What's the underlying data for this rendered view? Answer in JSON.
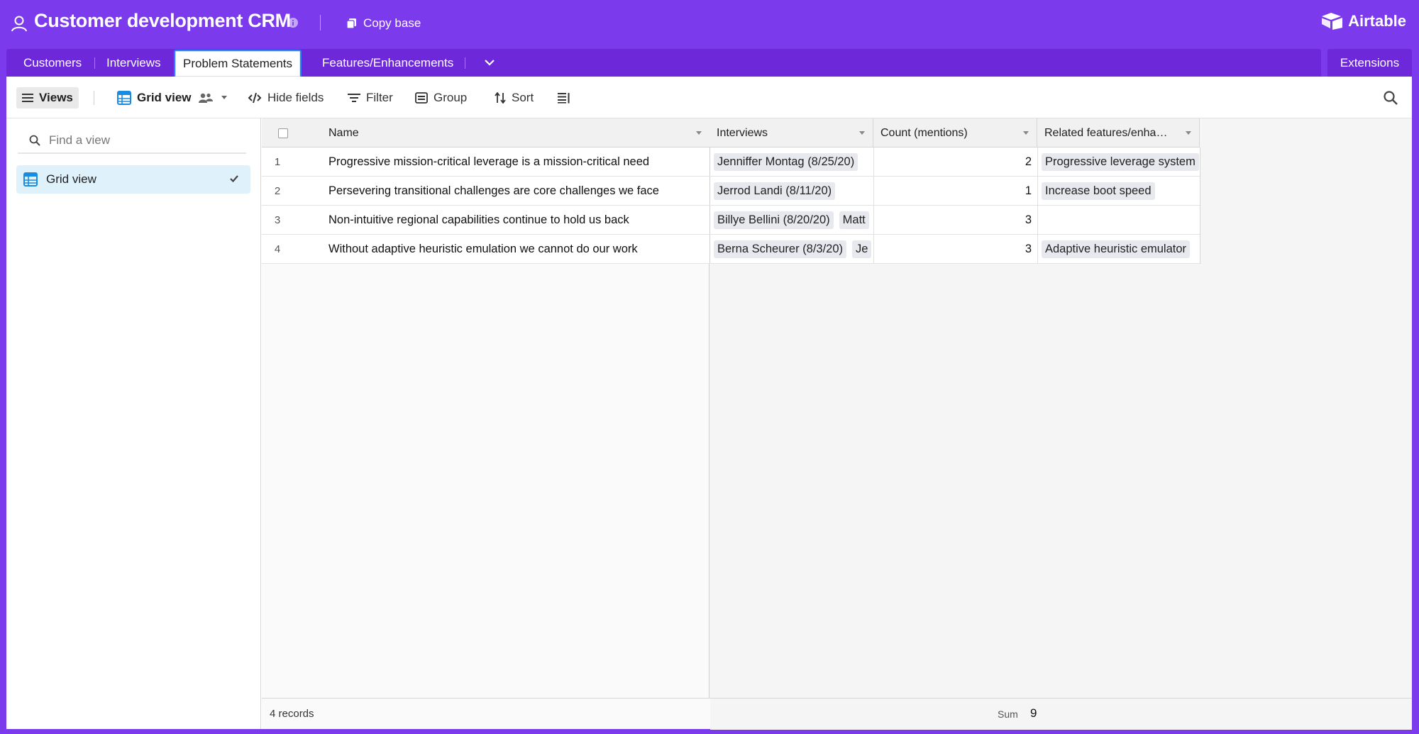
{
  "base": {
    "title": "Customer development CRM",
    "copy_label": "Copy base",
    "brand": "Airtable"
  },
  "tabs": [
    {
      "label": "Customers"
    },
    {
      "label": "Interviews"
    },
    {
      "label": "Problem Statements",
      "active": true
    },
    {
      "label": "Features/Enhancements"
    }
  ],
  "extensions_label": "Extensions",
  "toolbar": {
    "views_label": "Views",
    "grid_view_label": "Grid view",
    "hide_fields_label": "Hide fields",
    "filter_label": "Filter",
    "group_label": "Group",
    "sort_label": "Sort"
  },
  "sidebar": {
    "find_placeholder": "Find a view",
    "items": [
      {
        "label": "Grid view",
        "selected": true
      }
    ]
  },
  "grid": {
    "columns": [
      "Name",
      "Interviews",
      "Count (mentions)",
      "Related features/enha…"
    ],
    "rows": [
      {
        "num": "1",
        "name": "Progressive mission-critical leverage is a mission-critical need",
        "interviews": [
          "Jenniffer Montag (8/25/20)"
        ],
        "count": "2",
        "related": [
          "Progressive leverage system"
        ]
      },
      {
        "num": "2",
        "name": "Persevering transitional challenges are core challenges we face",
        "interviews": [
          "Jerrod Landi (8/11/20)"
        ],
        "count": "1",
        "related": [
          "Increase boot speed"
        ]
      },
      {
        "num": "3",
        "name": "Non-intuitive regional capabilities continue to hold us back",
        "interviews": [
          "Billye Bellini (8/20/20)",
          "Matt"
        ],
        "count": "3",
        "related": []
      },
      {
        "num": "4",
        "name": "Without adaptive heuristic emulation we cannot do our work",
        "interviews": [
          "Berna Scheurer (8/3/20)",
          "Je"
        ],
        "count": "3",
        "related": [
          "Adaptive heuristic emulator"
        ]
      }
    ],
    "footer": {
      "records": "4 records",
      "sum_label": "Sum",
      "sum_value": "9"
    }
  },
  "colors": {
    "brand_purple": "#7c3aed",
    "tab_bar": "#6d28d9",
    "accent_blue": "#2d7ff9",
    "selected_view": "#dff1fb"
  },
  "icons": [
    "user-icon",
    "info-icon",
    "copy-icon",
    "airtable-logo-icon",
    "chevron-down-icon",
    "hamburger-icon",
    "grid-icon",
    "people-icon",
    "caret-down-icon",
    "hide-fields-icon",
    "filter-icon",
    "group-icon",
    "sort-icon",
    "row-height-icon",
    "search-icon",
    "check-icon"
  ]
}
